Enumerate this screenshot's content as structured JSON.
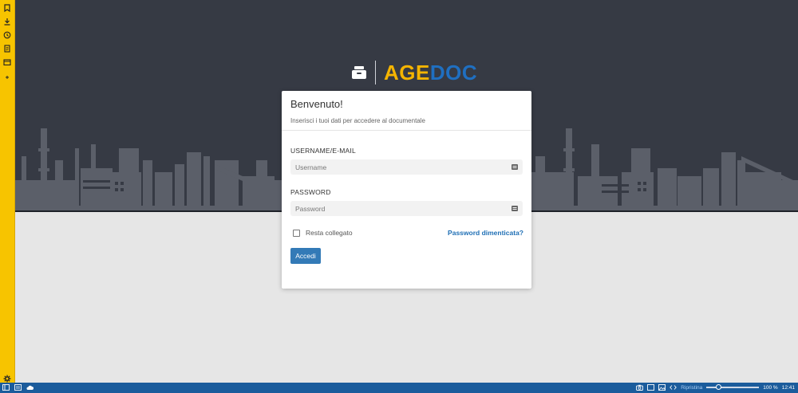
{
  "sidebar": {
    "icons": [
      "bookmark-icon",
      "download-icon",
      "history-icon",
      "notes-icon",
      "window-icon",
      "plus-icon",
      "settings-icon"
    ]
  },
  "logo": {
    "part1": "AGE",
    "part2": "DOC",
    "color1": "#f5b400",
    "color2": "#1f6fc1"
  },
  "login": {
    "title": "Benvenuto!",
    "subtitle": "Inserisci i tuoi dati per accedere al documentale",
    "username_label": "USERNAME/E-MAIL",
    "username_placeholder": "Username",
    "password_label": "PASSWORD",
    "password_placeholder": "Password",
    "remember_label": "Resta collegato",
    "remember_checked": false,
    "forgot_label": "Password dimenticata?",
    "submit_label": "Accedi",
    "button_color": "#337ab7"
  },
  "statusbar": {
    "reset_label": "Ripristina",
    "zoom": "100 %",
    "time": "12:41"
  },
  "colors": {
    "sidebar": "#f7c400",
    "header_bg": "#363a44",
    "page_bg": "#e6e6e6",
    "taskbar": "#1b5c9c"
  }
}
